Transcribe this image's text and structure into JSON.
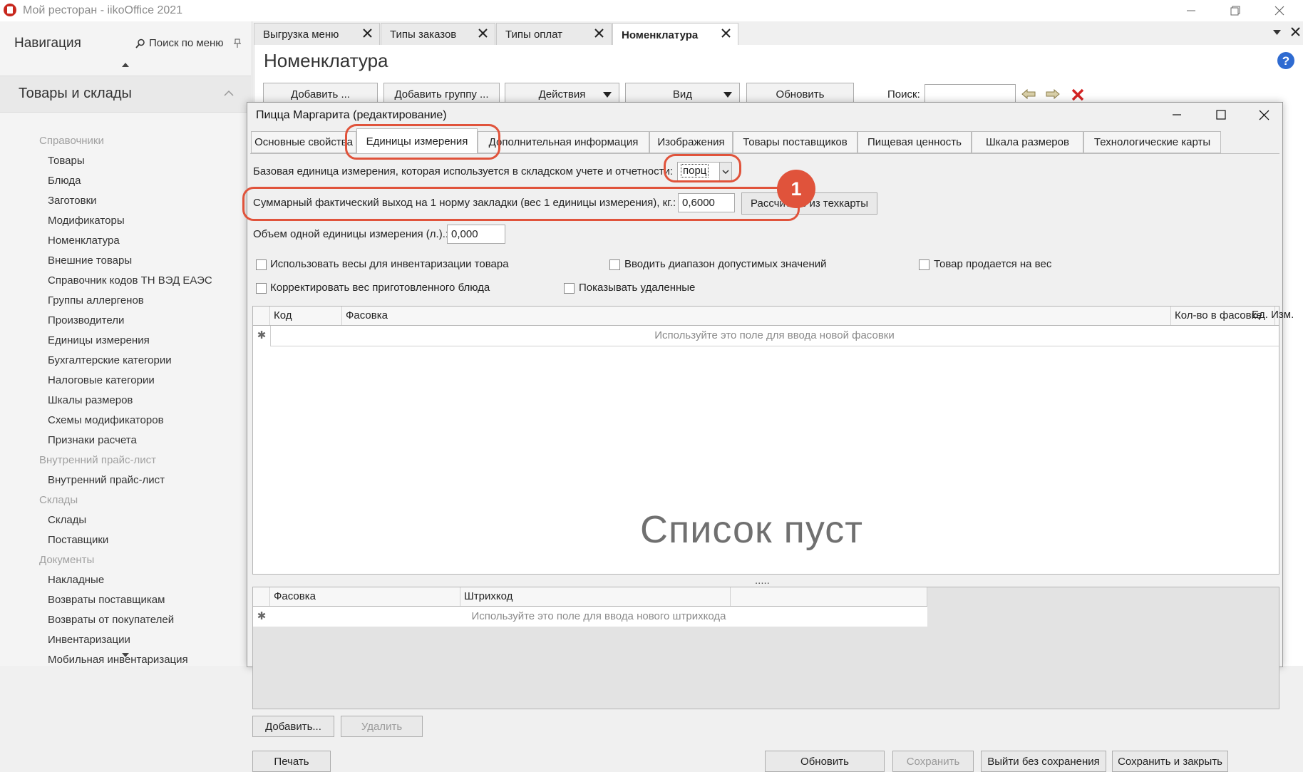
{
  "window": {
    "title": "Мой ресторан - iikoOffice 2021"
  },
  "nav": {
    "title": "Навигация",
    "search_label": "Поиск по меню",
    "section": "Товары и склады",
    "groups": [
      {
        "category": "Справочники",
        "items": [
          "Товары",
          "Блюда",
          "Заготовки",
          "Модификаторы",
          "Номенклатура",
          "Внешние товары",
          "Справочник кодов ТН ВЭД ЕАЭС",
          "Группы аллергенов",
          "Производители",
          "Единицы измерения",
          "Бухгалтерские категории",
          "Налоговые категории",
          "Шкалы размеров",
          "Схемы модификаторов",
          "Признаки расчета"
        ]
      },
      {
        "category": "Внутренний прайс-лист",
        "items": [
          "Внутренний прайс-лист"
        ]
      },
      {
        "category": "Склады",
        "items": [
          "Склады",
          "Поставщики"
        ]
      },
      {
        "category": "Документы",
        "items": [
          "Накладные",
          "Возвраты поставщикам",
          "Возвраты от покупателей",
          "Инвентаризации",
          "Мобильная инвентаризация"
        ]
      }
    ]
  },
  "tabs": [
    {
      "label": "Выгрузка меню"
    },
    {
      "label": "Типы заказов"
    },
    {
      "label": "Типы оплат"
    },
    {
      "label": "Номенклатура"
    }
  ],
  "main": {
    "title": "Номенклатура",
    "toolbar": {
      "add": "Добавить ...",
      "add_group": "Добавить группу ...",
      "actions": "Действия",
      "view": "Вид",
      "refresh": "Обновить"
    },
    "search_label": "Поиск:",
    "search_value": ""
  },
  "dialog": {
    "title": "Пицца Маргарита (редактирование)",
    "tabs": [
      "Основные свойства",
      "Единицы измерения",
      "Дополнительная информация",
      "Изображения",
      "Товары поставщиков",
      "Пищевая ценность",
      "Шкала размеров",
      "Технологические карты"
    ],
    "active_tab": "Единицы измерения",
    "base_unit_label": "Базовая единица измерения, которая используется в складском учете и отчетности:",
    "base_unit_value": "порц",
    "yield_label": "Суммарный фактический выход на 1 норму закладки (вес 1 единицы измерения), кг.:",
    "yield_value": "0,6000",
    "calc_button": "Рассчитать из техкарты",
    "volume_label": "Объем одной единицы измерения (л.).:",
    "volume_value": "0,000",
    "checkboxes": {
      "use_scales": "Использовать весы для инвентаризации товара",
      "range": "Вводить диапазон допустимых значений",
      "sold_by_weight": "Товар продается на вес",
      "correct_weight": "Корректировать вес приготовленного блюда",
      "show_deleted": "Показывать удаленные"
    },
    "grid1": {
      "columns": [
        "Код",
        "Фасовка",
        "Кол-во в фасовке",
        "Ед. Изм."
      ],
      "new_row_hint": "Используйте это поле для ввода новой фасовки"
    },
    "splitter": ".....",
    "grid2": {
      "columns": [
        "Фасовка",
        "Штрихкод"
      ],
      "new_row_hint": "Используйте это поле для ввода нового штрихкода",
      "empty_text": "Список пуст"
    },
    "add_button": "Добавить...",
    "delete_button": "Удалить",
    "footer": {
      "print": "Печать",
      "refresh": "Обновить",
      "save": "Сохранить",
      "exit": "Выйти без сохранения",
      "save_close": "Сохранить и закрыть"
    }
  },
  "annotation": {
    "badge": "1",
    "color": "#e0533b"
  }
}
